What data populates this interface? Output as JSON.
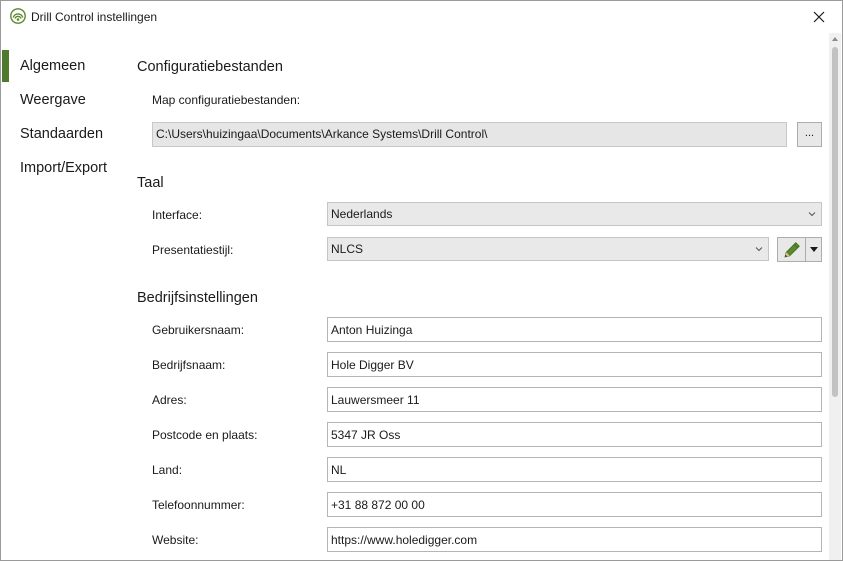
{
  "window": {
    "title": "Drill Control instellingen",
    "app_icon": "drill-control-logo-icon",
    "close_icon": "close-icon"
  },
  "sidebar": {
    "items": [
      {
        "label": "Algemeen",
        "active": true
      },
      {
        "label": "Weergave",
        "active": false
      },
      {
        "label": "Standaarden",
        "active": false
      },
      {
        "label": "Import/Export",
        "active": false
      }
    ]
  },
  "config": {
    "section_title": "Configuratiebestanden",
    "folder_label": "Map configuratiebestanden:",
    "folder_path": "C:\\Users\\huizingaa\\Documents\\Arkance Systems\\Drill Control\\",
    "browse_label": "..."
  },
  "language": {
    "section_title": "Taal",
    "interface_label": "Interface:",
    "interface_value": "Nederlands",
    "style_label": "Presentatiestijl:",
    "style_value": "NLCS",
    "edit_icon": "pencil-icon"
  },
  "company": {
    "section_title": "Bedrijfsinstellingen",
    "fields": [
      {
        "label": "Gebruikersnaam:",
        "value": "Anton Huizinga"
      },
      {
        "label": "Bedrijfsnaam:",
        "value": "Hole Digger BV"
      },
      {
        "label": "Adres:",
        "value": "Lauwersmeer 11"
      },
      {
        "label": "Postcode en plaats:",
        "value": "5347 JR Oss"
      },
      {
        "label": "Land:",
        "value": "NL"
      },
      {
        "label": "Telefoonnummer:",
        "value": "+31 88 872 00 00"
      },
      {
        "label": "Website:",
        "value": "https://www.holedigger.com"
      }
    ]
  },
  "colors": {
    "accent": "#4e7a2e",
    "pencil": "#5a8a2c",
    "field_readonly_bg": "#e6e6e6"
  }
}
